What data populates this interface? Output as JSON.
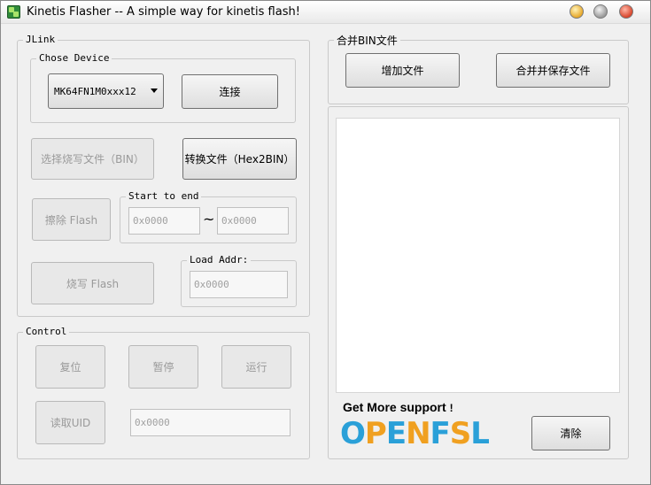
{
  "window": {
    "title": "Kinetis Flasher -- A simple way for kinetis flash!"
  },
  "jlink": {
    "group_label": "JLink",
    "chose_device_label": "Chose Device",
    "device_selected": "MK64FN1M0xxx12",
    "connect_button": "连接",
    "select_file_button": "选择烧写文件（BIN）",
    "convert_button": "转换文件（Hex2BIN）",
    "erase_button": "擦除  Flash",
    "start_to_end_label": "Start to end",
    "start_addr_placeholder": "0x0000",
    "end_addr_placeholder": "0x0000",
    "range_separator": "~",
    "program_button": "烧写  Flash",
    "load_addr_label": "Load Addr:",
    "load_addr_placeholder": "0x0000"
  },
  "control": {
    "group_label": "Control",
    "reset_button": "复位",
    "pause_button": "暂停",
    "run_button": "运行",
    "read_uid_button": "读取UID",
    "uid_placeholder": "0x0000"
  },
  "merge": {
    "group_label": "合并BIN文件",
    "add_file_button": "增加文件",
    "merge_save_button": "合并并保存文件",
    "clear_button": "清除"
  },
  "branding": {
    "support_text": "Get More support",
    "support_suffix": "!",
    "logo_letters": [
      "O",
      "P",
      "E",
      "N",
      "F",
      "S",
      "L"
    ]
  },
  "colors": {
    "logo_blue": "#2aa0d8",
    "logo_orange": "#f0a020"
  }
}
